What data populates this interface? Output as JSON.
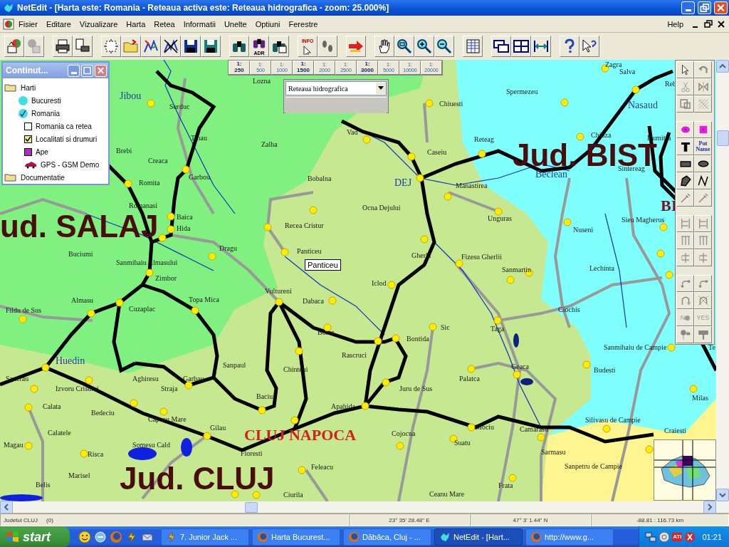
{
  "window": {
    "title": "NetEdit - [Harta este:  Romania - Reteaua activa este:  Reteaua hidrografica  - zoom: 25.000%]"
  },
  "menu": [
    "Fisier",
    "Editare",
    "Vizualizare",
    "Harta",
    "Retea",
    "Informatii",
    "Unelte",
    "Optiuni",
    "Ferestre"
  ],
  "help_menu": "Help",
  "toolbar": {
    "info_icon_text": "INFO",
    "adr_icon_text": "ADR"
  },
  "scale_buttons": [
    {
      "ratio": "1:",
      "value": "250",
      "active": true
    },
    {
      "ratio": "1:",
      "value": "500",
      "active": false
    },
    {
      "ratio": "1:",
      "value": "1000",
      "active": false
    },
    {
      "ratio": "1:",
      "value": "1500",
      "active": true
    },
    {
      "ratio": "1:",
      "value": "2000",
      "active": false
    },
    {
      "ratio": "1:",
      "value": "2500",
      "active": false
    },
    {
      "ratio": "1:",
      "value": "3000",
      "active": true
    },
    {
      "ratio": "1:",
      "value": "5000",
      "active": false
    },
    {
      "ratio": "1:",
      "value": "10000",
      "active": false
    },
    {
      "ratio": "1:",
      "value": "20000",
      "active": false
    }
  ],
  "layer_select": {
    "value": "Reteaua hidrografica"
  },
  "contents_window": {
    "title": "Continut...",
    "tree": [
      {
        "kind": "folder",
        "label": "Harti",
        "children": [
          {
            "kind": "map",
            "label": "Bucuresti",
            "checked": false
          },
          {
            "kind": "map",
            "label": "Romania",
            "checked": true,
            "children": [
              {
                "kind": "layer",
                "label": "Romania ca retea",
                "checked": false
              },
              {
                "kind": "layer",
                "label": "Localitati si drumuri",
                "checked": true
              },
              {
                "kind": "swatch",
                "label": "Ape",
                "color": "#b02cc0"
              },
              {
                "kind": "gps",
                "label": "GPS - GSM Demo"
              }
            ]
          }
        ]
      },
      {
        "kind": "folder",
        "label": "Documentatie"
      }
    ]
  },
  "draw_toolbar": {
    "put_name_text": "Put Name",
    "no_text": "N",
    "yes_text": "YES"
  },
  "map": {
    "tooltip": "Panticeu",
    "region_labels": [
      {
        "text": "Jud. BIST",
        "kind": "county"
      },
      {
        "text": "BI",
        "kind": "city"
      },
      {
        "text": "ud. SALAJ",
        "kind": "county"
      },
      {
        "text": "CLUJ NAPOCA",
        "kind": "city"
      },
      {
        "text": "Jud. CLUJ",
        "kind": "county"
      }
    ],
    "labels": [
      {
        "text": "Zagra",
        "kind": "village"
      },
      {
        "text": "Salva",
        "kind": "village"
      },
      {
        "text": "Lozna",
        "kind": "village"
      },
      {
        "text": "Reb",
        "kind": "village"
      },
      {
        "text": "Jibou",
        "kind": "town"
      },
      {
        "text": "Spermezeu",
        "kind": "village"
      },
      {
        "text": "Surduc",
        "kind": "village"
      },
      {
        "text": "Chiuesti",
        "kind": "village"
      },
      {
        "text": "Nasaud",
        "kind": "town"
      },
      {
        "text": "Tihau",
        "kind": "village"
      },
      {
        "text": "Vad",
        "kind": "village"
      },
      {
        "text": "Reteag",
        "kind": "village"
      },
      {
        "text": "Chiuza",
        "kind": "village"
      },
      {
        "text": "Dumitra",
        "kind": "village"
      },
      {
        "text": "Brebi",
        "kind": "village"
      },
      {
        "text": "Zalha",
        "kind": "village"
      },
      {
        "text": "Caseiu",
        "kind": "village"
      },
      {
        "text": "Creaca",
        "kind": "village"
      },
      {
        "text": "Beclean",
        "kind": "town"
      },
      {
        "text": "Sintereag",
        "kind": "village"
      },
      {
        "text": "Romita",
        "kind": "village"
      },
      {
        "text": "Garbou",
        "kind": "village"
      },
      {
        "text": "Bobalna",
        "kind": "village"
      },
      {
        "text": "DEJ",
        "kind": "town"
      },
      {
        "text": "Manastirea",
        "kind": "village"
      },
      {
        "text": "Romanasi",
        "kind": "village"
      },
      {
        "text": "Ocna Dejului",
        "kind": "village"
      },
      {
        "text": "Baica",
        "kind": "village"
      },
      {
        "text": "Unguras",
        "kind": "village"
      },
      {
        "text": "Sieu Magherus",
        "kind": "village"
      },
      {
        "text": "Hida",
        "kind": "village"
      },
      {
        "text": "Recea Cristur",
        "kind": "village"
      },
      {
        "text": "Nuseni",
        "kind": "village"
      },
      {
        "text": "Buciumi",
        "kind": "village"
      },
      {
        "text": "Dragu",
        "kind": "village"
      },
      {
        "text": "Panticeu",
        "kind": "village"
      },
      {
        "text": "Gherla",
        "kind": "village"
      },
      {
        "text": "Fizesu Gherlii",
        "kind": "village"
      },
      {
        "text": "Sanmihaiu Almasului",
        "kind": "village"
      },
      {
        "text": "Sanmartin",
        "kind": "village"
      },
      {
        "text": "Lechinta",
        "kind": "village"
      },
      {
        "text": "Zimbor",
        "kind": "village"
      },
      {
        "text": "Iclod",
        "kind": "village"
      },
      {
        "text": "Vultureni",
        "kind": "village"
      },
      {
        "text": "Almasu",
        "kind": "village"
      },
      {
        "text": "Topa Mica",
        "kind": "village"
      },
      {
        "text": "Dabaca",
        "kind": "village"
      },
      {
        "text": "Fildu de Sus",
        "kind": "village"
      },
      {
        "text": "Cuzaplac",
        "kind": "village"
      },
      {
        "text": "Ciochis",
        "kind": "village"
      },
      {
        "text": "Borsa",
        "kind": "village"
      },
      {
        "text": "Sic",
        "kind": "village"
      },
      {
        "text": "Taga",
        "kind": "village"
      },
      {
        "text": "Bontida",
        "kind": "village"
      },
      {
        "text": "Sanmihaiu de Campie",
        "kind": "village"
      },
      {
        "text": "Te",
        "kind": "village"
      },
      {
        "text": "Rascruci",
        "kind": "village"
      },
      {
        "text": "Huedin",
        "kind": "town"
      },
      {
        "text": "Sanpaul",
        "kind": "village"
      },
      {
        "text": "Chinteni",
        "kind": "village"
      },
      {
        "text": "Geaca",
        "kind": "village"
      },
      {
        "text": "Budesti",
        "kind": "village"
      },
      {
        "text": "Sancrau",
        "kind": "village"
      },
      {
        "text": "Aghiresu",
        "kind": "village"
      },
      {
        "text": "Garbau",
        "kind": "village"
      },
      {
        "text": "Palatca",
        "kind": "village"
      },
      {
        "text": "Izvoru Crisului",
        "kind": "village"
      },
      {
        "text": "Straja",
        "kind": "village"
      },
      {
        "text": "Juru de Sus",
        "kind": "village"
      },
      {
        "text": "Baciu",
        "kind": "village"
      },
      {
        "text": "Milas",
        "kind": "village"
      },
      {
        "text": "Calata",
        "kind": "village"
      },
      {
        "text": "Apahida",
        "kind": "village"
      },
      {
        "text": "Bedeciu",
        "kind": "village"
      },
      {
        "text": "Capusu Mare",
        "kind": "village"
      },
      {
        "text": "Silivasu de Campie",
        "kind": "village"
      },
      {
        "text": "Calatele",
        "kind": "village"
      },
      {
        "text": "Gilau",
        "kind": "village"
      },
      {
        "text": "Cojocna",
        "kind": "village"
      },
      {
        "text": "Mociu",
        "kind": "village"
      },
      {
        "text": "Camarasu",
        "kind": "village"
      },
      {
        "text": "Craiesti",
        "kind": "village"
      },
      {
        "text": "Magau",
        "kind": "village"
      },
      {
        "text": "Somesu Cald",
        "kind": "village"
      },
      {
        "text": "Suatu",
        "kind": "village"
      },
      {
        "text": "Risca",
        "kind": "village"
      },
      {
        "text": "Floresti",
        "kind": "village"
      },
      {
        "text": "Sarmasu",
        "kind": "village"
      },
      {
        "text": "Feleacu",
        "kind": "village"
      },
      {
        "text": "Sanpetru de Campie",
        "kind": "village"
      },
      {
        "text": "Marisel",
        "kind": "village"
      },
      {
        "text": "Belis",
        "kind": "village"
      },
      {
        "text": "Frata",
        "kind": "village"
      },
      {
        "text": "Ciurila",
        "kind": "village"
      },
      {
        "text": "Ceanu Mare",
        "kind": "village"
      }
    ]
  },
  "status_bar": {
    "county": "Judetul CLUJ",
    "count": "(0)",
    "longitude": "23° 35' 28.48\" E",
    "latitude": "47° 3' 1.44\" N",
    "scale": "-88.81 : 116.73 km"
  },
  "taskbar": {
    "start": "start",
    "tasks": [
      {
        "label": "7. Junior Jack ...",
        "selected": false
      },
      {
        "label": "Harta Bucurest...",
        "selected": false
      },
      {
        "label": "Dăbâca, Cluj - ...",
        "selected": false
      },
      {
        "label": "NetEdit - [Hart...",
        "selected": true
      },
      {
        "label": "http://www.g...",
        "selected": false
      }
    ],
    "tray_text": "ATI",
    "clock": "01:21"
  }
}
